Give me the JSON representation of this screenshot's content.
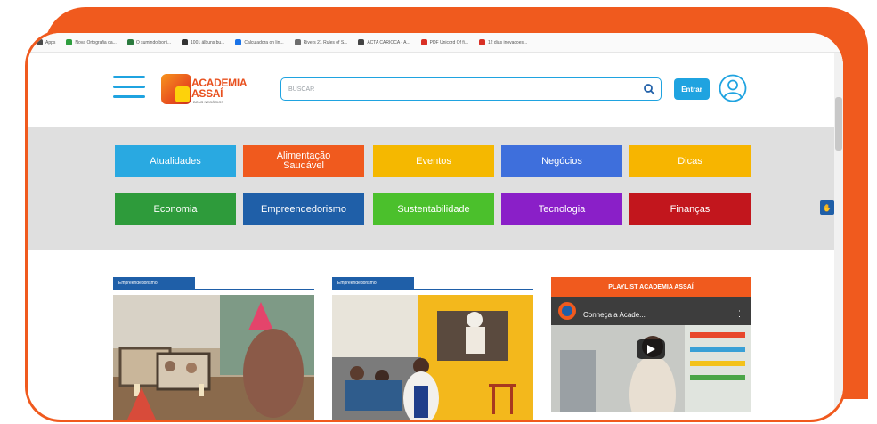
{
  "bookmarks": [
    {
      "label": "Apps",
      "color": "#4a4a4a"
    },
    {
      "label": "Nova Ortografia da...",
      "color": "#2e9e3e"
    },
    {
      "label": "O sumindo boni...",
      "color": "#2b7a3e"
    },
    {
      "label": "1001 álbuns bu...",
      "color": "#333333"
    },
    {
      "label": "Calculadora on lin...",
      "color": "#1a73e8"
    },
    {
      "label": "Rivers 21 Rules of S...",
      "color": "#6d6d6d"
    },
    {
      "label": "ACTA CARIOCA - A...",
      "color": "#444444"
    },
    {
      "label": "PDF Unicord Of fi...",
      "color": "#d93025"
    },
    {
      "label": "12 dias inovacoes...",
      "color": "#d93025"
    }
  ],
  "header": {
    "logo_line1": "ACADEMIA",
    "logo_line2": "ASSAÍ",
    "logo_line3": "BONS NEGÓCIOS",
    "search_placeholder": "BUSCAR",
    "enter_label": "Entrar"
  },
  "categories": [
    {
      "label": "Atualidades",
      "color": "#29a9e1"
    },
    {
      "label": "Alimentação Saudável",
      "color": "#f05a1e"
    },
    {
      "label": "Eventos",
      "color": "#f5b800"
    },
    {
      "label": "Negócios",
      "color": "#3e6fdc"
    },
    {
      "label": "Dicas",
      "color": "#f7b500"
    },
    {
      "label": "Economia",
      "color": "#2e9b3b"
    },
    {
      "label": "Empreendedorismo",
      "color": "#1f5fa8"
    },
    {
      "label": "Sustentabilidade",
      "color": "#4bc02c"
    },
    {
      "label": "Tecnologia",
      "color": "#8a1fc8"
    },
    {
      "label": "Finanças",
      "color": "#c2161d"
    }
  ],
  "cards": [
    {
      "tag": "Empreendedorismo"
    },
    {
      "tag": "Empreendedorismo"
    }
  ],
  "playlist": {
    "title": "PLAYLIST ACADEMIA ASSAÍ",
    "video_title": "Conheça a Acade..."
  }
}
